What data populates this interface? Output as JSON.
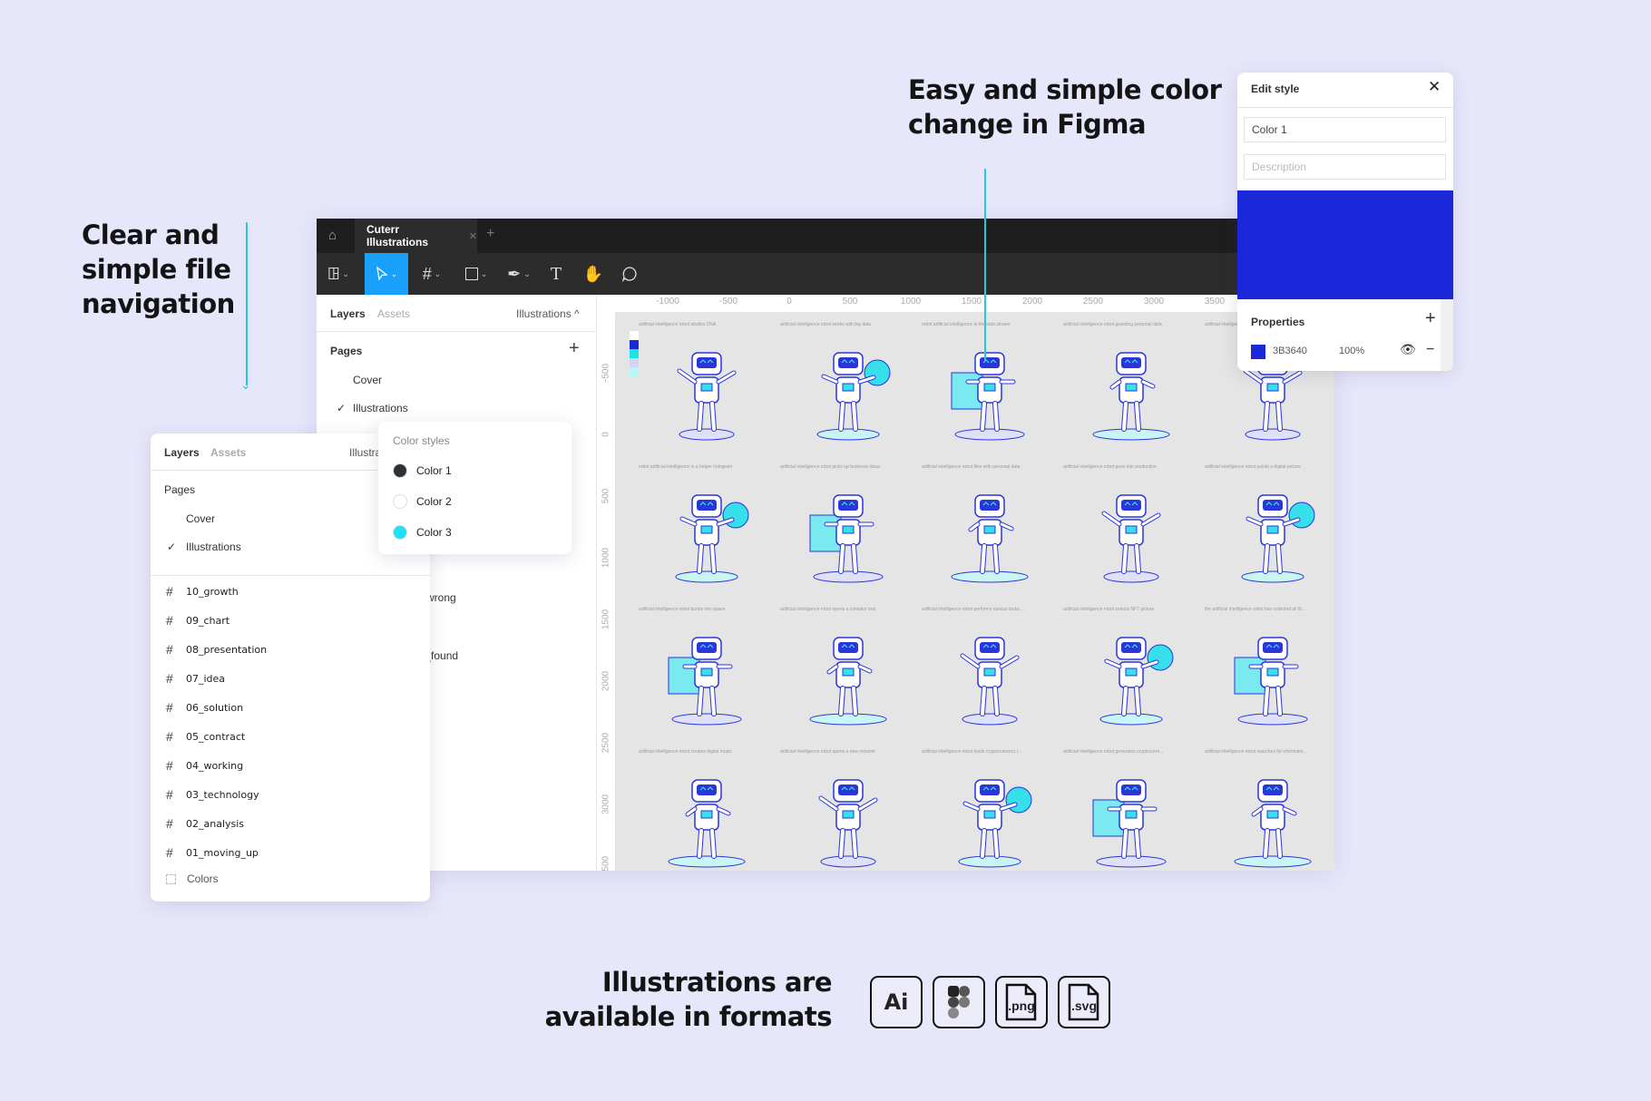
{
  "headlines": {
    "navigation": [
      "Clear and",
      "simple file",
      "navigation"
    ],
    "color": [
      "Easy and simple color",
      "change in Figma"
    ],
    "formats": [
      "Illustrations are",
      "available in formats"
    ]
  },
  "formats": [
    {
      "icon": "adobe-illustrator-icon",
      "label": "Ai"
    },
    {
      "icon": "figma-icon",
      "label": ""
    },
    {
      "icon": "png-file-icon",
      "label": ".png"
    },
    {
      "icon": "svg-file-icon",
      "label": ".svg"
    }
  ],
  "window": {
    "tab": "Cuterr Illustrations",
    "tools": [
      "figma-menu",
      "move",
      "frame",
      "rectangle",
      "pen",
      "text",
      "hand",
      "comment"
    ],
    "left_panel": {
      "tab_layers": "Layers",
      "tab_assets": "Assets",
      "page_selector": "Illustrations ^",
      "pages_title": "Pages",
      "pages": [
        "Cover",
        "Illustrations"
      ],
      "hidden_layers": [
        "wrong",
        "t_found"
      ]
    },
    "ruler_h": [
      "-1000",
      "-500",
      "0",
      "500",
      "1000",
      "1500",
      "2000",
      "2500",
      "3000",
      "3500"
    ],
    "ruler_v": [
      "-500",
      "0",
      "500",
      "1000",
      "1500",
      "2000",
      "2500",
      "3000",
      "3500"
    ],
    "swatches": [
      "#ffffff",
      "#1b28d6",
      "#19e6e0",
      "#d2d4f5",
      "#b9f6f6"
    ],
    "illustrations": [
      "artificial intelligence robot studies DNA",
      "artificial intelligence robot works with big data",
      "robot artificial intelligence in the data stream",
      "artificial intelligence robot guarding personal data",
      "artificial intelligence robot ...",
      "robot artificial intelligence in a helper hologram",
      "artificial intelligence robot picks up business ideas",
      "artificial intelligence robot files with personal data",
      "artificial intelligence robot goes into production",
      "artificial intelligence robot paints a digital picture",
      "artificial intelligence robot bursts into space",
      "artificial intelligence robot opens a complex lock",
      "artificial intelligence robot performs various tasks ...",
      "artificial intelligence robot selects NFT picture",
      "the artificial intelligence robot has collected all th...",
      "artificial intelligence robot creates digital music",
      "artificial intelligence robot opens a new network",
      "artificial intelligence robot loads cryptocurrency i...",
      "artificial intelligence robot generates cryptocurre...",
      "artificial intelligence robot searches for informatio..."
    ]
  },
  "front_panel": {
    "tab_layers": "Layers",
    "tab_assets": "Assets",
    "page_selector": "Illustra",
    "pages_title": "Pages",
    "pages": [
      "Cover",
      "Illustrations"
    ],
    "layers": [
      "10_growth",
      "09_chart",
      "08_presentation",
      "07_idea",
      "06_solution",
      "05_contract",
      "04_working",
      "03_technology",
      "02_analysis",
      "01_moving_up"
    ],
    "colors_layer": "Colors"
  },
  "color_styles": {
    "title": "Color styles",
    "items": [
      {
        "label": "Color 1",
        "color": "#2b3336"
      },
      {
        "label": "Color 2",
        "color": "#ffffff"
      },
      {
        "label": "Color 3",
        "color": "#1fe0f5"
      }
    ]
  },
  "edit_style": {
    "title": "Edit style",
    "name_value": "Color 1",
    "description_placeholder": "Description",
    "preview_color": "#1b28d9",
    "properties_title": "Properties",
    "hex": "3B3640",
    "opacity": "100%"
  }
}
